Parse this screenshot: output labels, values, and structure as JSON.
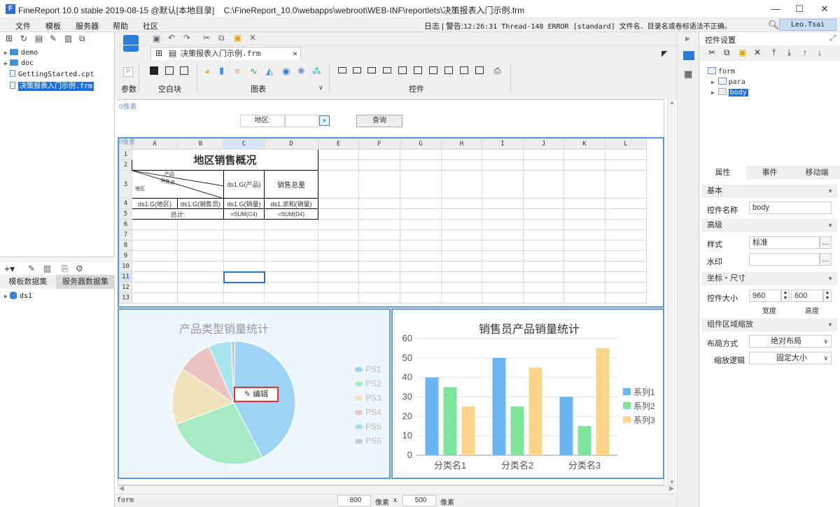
{
  "window": {
    "logo": "F",
    "title": "FineReport 10.0 stable 2019-08-15 @默认[本地目录]",
    "path": "C:\\FineReport_10.0\\webapps\\webroot\\WEB-INF\\reportlets\\决策报表入门示例.frm",
    "btn_min": "—",
    "btn_max": "☐",
    "btn_close": "✕"
  },
  "menu": {
    "items": [
      "文件",
      "模板",
      "服务器",
      "帮助",
      "社区"
    ],
    "log_label": "日志",
    "alert_label": "警告:",
    "alert_text": "12:26:31 Thread-148 ERROR [standard] 文件名、目录名或卷标语法不正确。",
    "user": "Leo.Tsai"
  },
  "tree": {
    "items": [
      {
        "name": "demo",
        "type": "folder"
      },
      {
        "name": "doc",
        "type": "folder"
      },
      {
        "name": "GettingStarted.cpt",
        "type": "file"
      },
      {
        "name": "决策报表入门示例.frm",
        "type": "file",
        "selected": true
      }
    ]
  },
  "datasets": {
    "tabs": [
      "模板数据集",
      "服务器数据集"
    ],
    "items": [
      "ds1"
    ]
  },
  "editor": {
    "tab_label": "决策报表入门示例.frm",
    "ribbon": {
      "param": "参数",
      "blank": "空白块",
      "chart": "图表",
      "widget": "控件"
    }
  },
  "para_panel": {
    "label": "0像素",
    "area_label": "地区:",
    "query_button": "查询"
  },
  "sheet": {
    "label": "0像素",
    "col_headers": [
      "A",
      "B",
      "C",
      "D",
      "E",
      "F",
      "G",
      "H",
      "I",
      "J",
      "K",
      "L"
    ],
    "row_headers": [
      "1",
      "2",
      "3",
      "4",
      "5",
      "6",
      "7",
      "8",
      "9",
      "10",
      "11",
      "12",
      "13"
    ],
    "title": "地区销售概况",
    "diag_top": "产品",
    "diag_mid": "销售员",
    "diag_bot": "地区",
    "c3": "ds1.G(产品)",
    "d3": "销售总量",
    "a4": "ds1.G(地区)",
    "b4": "ds1.G(销售员)",
    "c4": "ds1.G(销量)",
    "d4": "ds1.求和(销量)",
    "ab5": "总计:",
    "c5": "=SUM(C4)",
    "d5": "=SUM(D4)"
  },
  "pie_chart": {
    "title": "产品类型销量统计",
    "edit_button": "编辑",
    "legend": [
      "PS1",
      "PS2",
      "PS3",
      "PS4",
      "PS5",
      "PS6"
    ],
    "values": [
      42,
      27,
      15,
      9,
      6,
      1
    ],
    "colors": [
      "#9fd3f5",
      "#a6ebc4",
      "#eee3ba",
      "#edc2c2",
      "#a9e5ef",
      "#c5ccd6"
    ]
  },
  "chart_data": {
    "type": "bar",
    "title": "销售员产品销量统计",
    "categories": [
      "分类名1",
      "分类名2",
      "分类名3"
    ],
    "series": [
      {
        "name": "系列1",
        "values": [
          40,
          50,
          30
        ],
        "color": "#6cb7f3"
      },
      {
        "name": "系列2",
        "values": [
          35,
          25,
          15
        ],
        "color": "#7fe39b"
      },
      {
        "name": "系列3",
        "values": [
          25,
          45,
          55
        ],
        "color": "#fcd58a"
      }
    ],
    "ylim": [
      0,
      60
    ],
    "yticks": [
      "0",
      "10",
      "20",
      "30",
      "40",
      "50",
      "60"
    ],
    "grid": true,
    "legend": "right"
  },
  "props": {
    "header": "控件设置",
    "tree": [
      "form",
      "para",
      "body"
    ],
    "tabs": [
      "属性",
      "事件",
      "移动端"
    ],
    "sec_basic": "基本",
    "name_label": "控件名称",
    "name_value": "body",
    "sec_advanced": "高级",
    "style_label": "样式",
    "style_value": "标准",
    "watermark_label": "水印",
    "watermark_value": "",
    "sec_coords": "坐标・尺寸",
    "size_label": "控件大小",
    "width_value": "960",
    "height_value": "600",
    "width_label": "宽度",
    "height_label": "高度",
    "sec_scale": "组件区域缩放",
    "layout_label": "布局方式",
    "layout_value": "绝对布局",
    "scale_label": "缩放逻辑",
    "scale_value": "固定大小"
  },
  "status": {
    "left": "form",
    "width_value": "800",
    "unit1": "像素",
    "x": "x",
    "height_value": "500",
    "unit2": "像素"
  }
}
